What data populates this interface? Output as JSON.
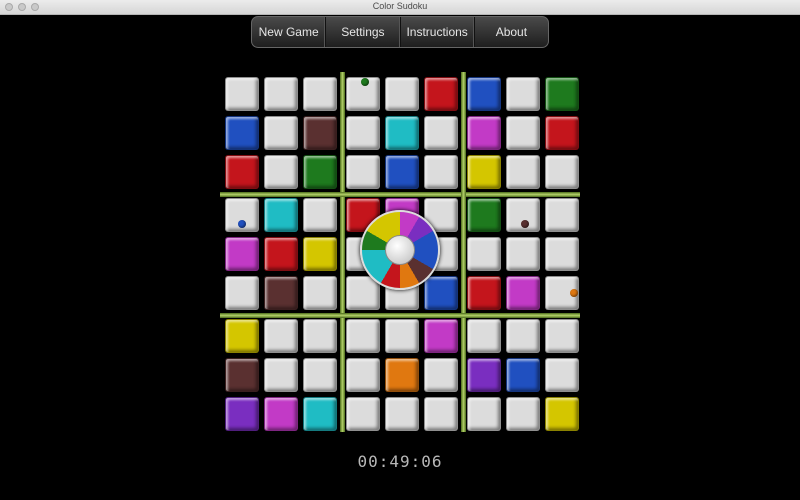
{
  "window": {
    "title": "Color Sudoku"
  },
  "menu": {
    "new_game": "New Game",
    "settings": "Settings",
    "instructions": "Instructions",
    "about": "About"
  },
  "colors": {
    "W": "#dcdcdc",
    "R": "#c4151c",
    "B": "#2050c0",
    "G": "#1e7a1e",
    "M": "#c23ac6",
    "C": "#1fbcc4",
    "Y": "#d4c600",
    "O": "#e07810",
    "P": "#7a2ec0",
    "N": "#5a3030"
  },
  "grid": [
    [
      "W",
      "W",
      "W",
      "W",
      "W",
      "R",
      "B",
      "W",
      "G"
    ],
    [
      "B",
      "W",
      "N",
      "W",
      "C",
      "W",
      "M",
      "W",
      "R"
    ],
    [
      "R",
      "W",
      "G",
      "W",
      "B",
      "W",
      "Y",
      "W",
      "W"
    ],
    [
      "W",
      "C",
      "W",
      "R",
      "M",
      "W",
      "G",
      "W",
      "W"
    ],
    [
      "M",
      "R",
      "Y",
      "W",
      "W",
      "W",
      "W",
      "W",
      "W"
    ],
    [
      "W",
      "N",
      "W",
      "W",
      "W",
      "B",
      "R",
      "M",
      "W"
    ],
    [
      "Y",
      "W",
      "W",
      "W",
      "W",
      "M",
      "W",
      "W",
      "W"
    ],
    [
      "N",
      "W",
      "W",
      "W",
      "O",
      "W",
      "P",
      "B",
      "W"
    ],
    [
      "P",
      "M",
      "C",
      "W",
      "W",
      "W",
      "W",
      "W",
      "Y"
    ]
  ],
  "palette": [
    "M",
    "P",
    "B",
    "B",
    "N",
    "O",
    "R",
    "C",
    "C",
    "G",
    "Y",
    "Y"
  ],
  "markers": [
    {
      "row": 0,
      "col": 3,
      "color": "G"
    },
    {
      "row": 3,
      "col": 0,
      "color": "B"
    },
    {
      "row": 3,
      "col": 7,
      "color": "N"
    },
    {
      "row": 5,
      "col": 8,
      "color": "O"
    }
  ],
  "timer": "00:49:06"
}
